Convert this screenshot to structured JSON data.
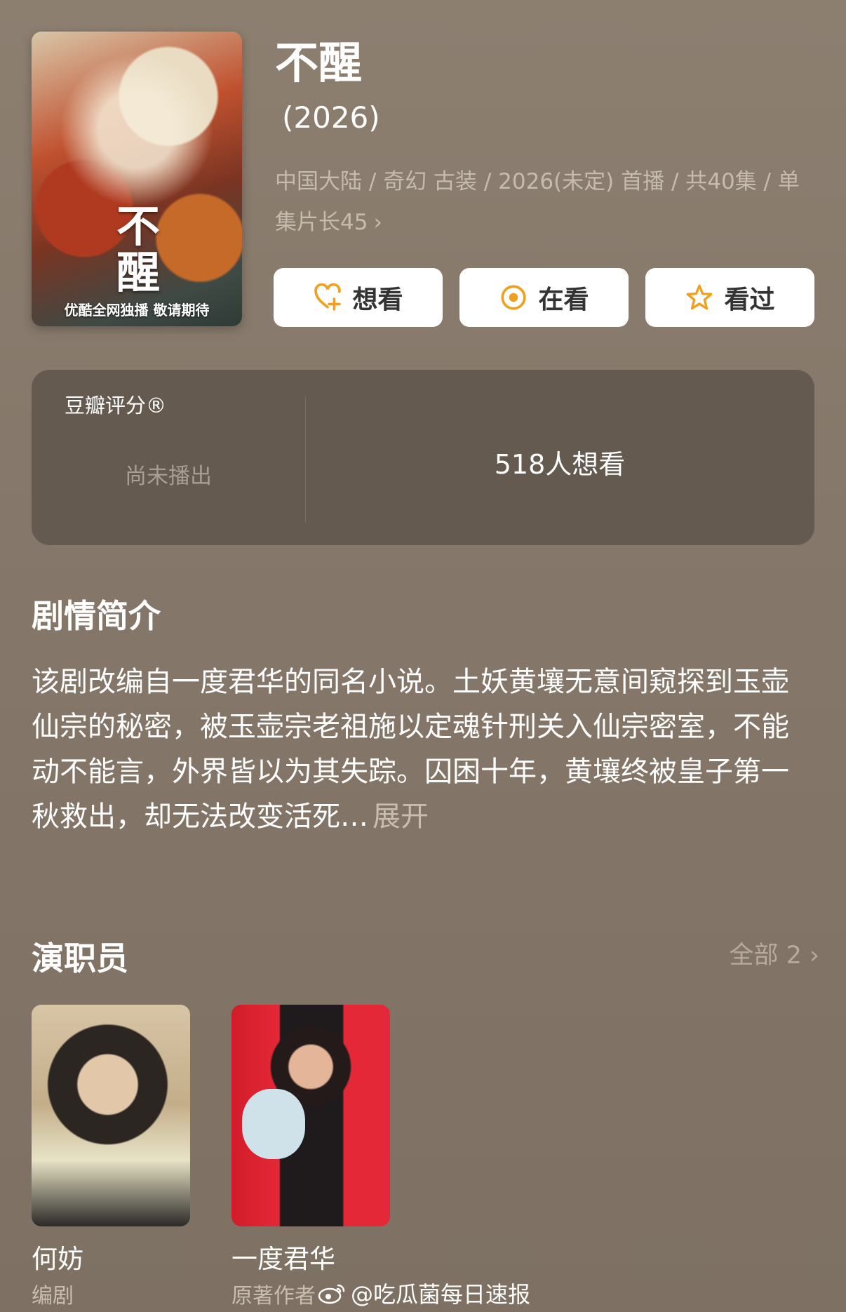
{
  "poster": {
    "title_text": "不醒",
    "caption": "优酷全网独播 敬请期待"
  },
  "show": {
    "title": "不醒",
    "year": "(2026)",
    "meta": "中国大陆 / 奇幻 古装 / 2026(未定) 首播 / 共40集 / 单集片长45"
  },
  "actions": {
    "want_label": "想看",
    "watching_label": "在看",
    "watched_label": "看过",
    "accent_color": "#f0a020"
  },
  "rating": {
    "label": "豆瓣评分®",
    "status": "尚未播出",
    "want_count": "518人想看"
  },
  "synopsis": {
    "title": "剧情简介",
    "text": "该剧改编自一度君华的同名小说。土妖黄壤无意间窥探到玉壶仙宗的秘密，被玉壶宗老祖施以定魂针刑关入仙宗密室，不能动不能言，外界皆以为其失踪。囚困十年，黄壤终被皇子第一秋救出，却无法改变活死…",
    "expand_label": "展开"
  },
  "cast": {
    "title": "演职员",
    "all_label": "全部 2",
    "members": [
      {
        "name": "何妨",
        "role": "编剧"
      },
      {
        "name": "一度君华",
        "role": "原著作者"
      }
    ]
  },
  "watermark": {
    "text": "@吃瓜菌每日速报"
  }
}
